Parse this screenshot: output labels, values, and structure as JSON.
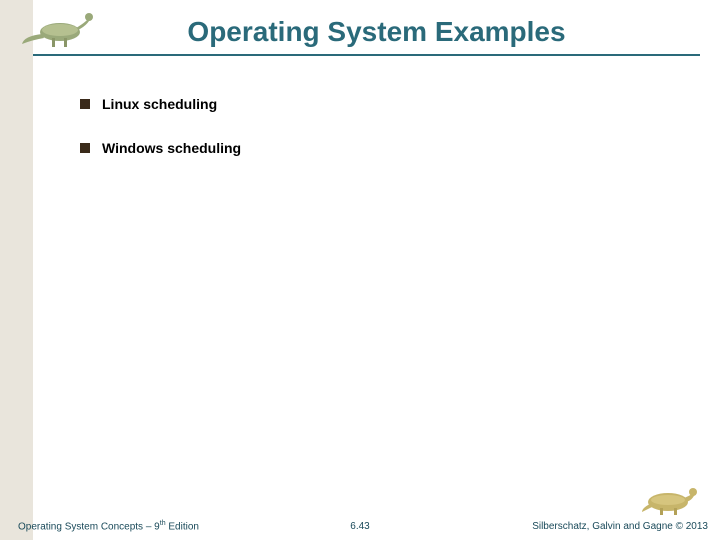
{
  "header": {
    "title": "Operating System Examples"
  },
  "bullets": {
    "item1": "Linux scheduling",
    "item2": "Windows scheduling"
  },
  "footer": {
    "left_prefix": "Operating System Concepts – 9",
    "left_suffix": " Edition",
    "left_super": "th",
    "center": "6.43",
    "right": "Silberschatz, Galvin and Gagne © 2013"
  },
  "icons": {
    "dino_top": "dinosaur-running-icon",
    "dino_bottom": "dinosaur-resting-icon"
  }
}
